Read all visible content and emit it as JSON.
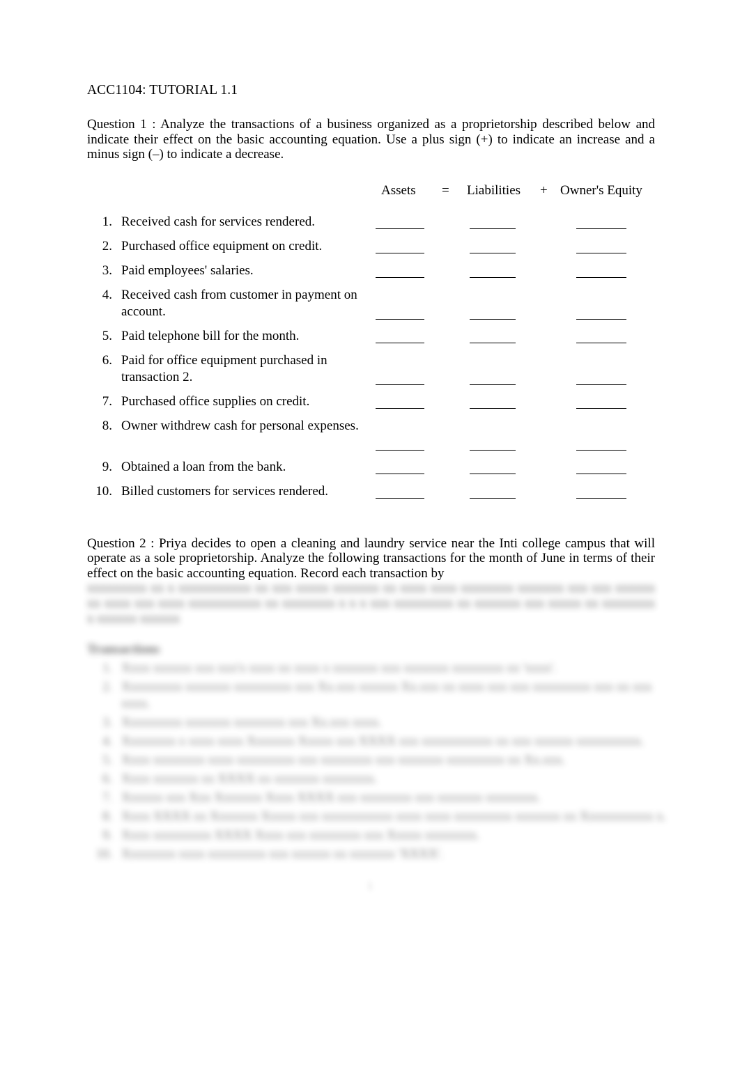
{
  "document": {
    "title": "ACC1104: TUTORIAL 1.1",
    "page_number": "1"
  },
  "question1": {
    "label": "Question 1",
    "body": "  : Analyze the transactions of a business organized as a proprietorship described below and indicate their effect on the basic accounting equation. Use a plus sign (+) to indicate an increase and a minus sign (–) to indicate a decrease.",
    "equation_headers": {
      "assets": "Assets",
      "equals": "=",
      "liabilities": "Liabilities",
      "plus": "+",
      "owners_equity": "Owner's Equity"
    },
    "items": [
      {
        "number": "1.",
        "text": "Received cash for services rendered."
      },
      {
        "number": "2.",
        "text": "Purchased office equipment on credit."
      },
      {
        "number": "3.",
        "text": "Paid employees' salaries."
      },
      {
        "number": "4.",
        "text": "Received cash from customer in payment on account."
      },
      {
        "number": "5.",
        "text": "Paid telephone bill for the month."
      },
      {
        "number": "6.",
        "text": "Paid for office equipment purchased in transaction 2."
      },
      {
        "number": "7.",
        "text": "Purchased office supplies on credit."
      },
      {
        "number": "8.",
        "text": "Owner withdrew cash for personal expenses."
      },
      {
        "number": "9.",
        "text": "Obtained a loan from the bank."
      },
      {
        "number": "10.",
        "text": "Billed customers for services rendered."
      }
    ]
  },
  "question2": {
    "label": "Question 2",
    "body_visible": "  : Priya decides to open a cleaning and laundry service near the Inti college campus that will operate as a sole proprietorship. Analyze the following transactions for the month of June in terms of their effect on the basic accounting equation. Record each transaction by",
    "body_blurred": "xxxxxxxxx xx x xxxxxxxxxxx xx xxx xxxxx xxxxxxx xx xxxx xxxx xxxxxxxx xxxxxxx xxx xxx xxxxxx xx xxxx xxx xxxx xxxxxxxxxxx xx xxxxxxxx x x x xxx xxxxxxxxx xx xxxxxxx xxx xxxxx xx xxxxxxxx x xxxxxx xxxxxx",
    "transactions_heading_blurred": "Transactions",
    "transactions_blurred": [
      {
        "number": "1.",
        "text": "Xxxx xxxxxx xxx xxx'x xxxx xx xxxx x xxxxxxx xxx xxxxxxx xxxxxxxx xx 'xxxx'."
      },
      {
        "number": "2.",
        "text": "Xxxxxxxxx xxxxxxx xxxxxxxxx xxx Xx.xxx xxxxxx Xx.xxx xx xxxx xxx xxx xxxxxxxxx xxx xx xxx xxxx."
      },
      {
        "number": "3.",
        "text": "Xxxxxxxxx xxxxxxx xxxxxxxx xxx Xx.xxx xxxx."
      },
      {
        "number": "4.",
        "text": "Xxxxxxxx x xxxx xxxx Xxxxxxx Xxxxx xxx XXXX xxx xxxxxxxxxxx xx xxx xxxxxx xxxxxxxxxx."
      },
      {
        "number": "5.",
        "text": "Xxxx xxxxxxxx xxxx xxxxxxxxx xxx xxxxxxxx xxx xxxxxxx xxxxxxxxx xx Xx.xxx."
      },
      {
        "number": "6.",
        "text": "Xxxx xxxxxxx xx XXXX xx xxxxxxx xxxxxxxx."
      },
      {
        "number": "7.",
        "text": "Xxxxxx xxx Xxx Xxxxxxx Xxxx XXXX xxx xxxxxxxx xxx xxxxxxx xxxxxxxx."
      },
      {
        "number": "8.",
        "text": "Xxxx XXXX xx Xxxxxxx Xxxxx xxx xxxxxxxxxxx xxxx xxxx xxxxxxxxx xxxxxxx xx Xxxxxxxxxxx x."
      },
      {
        "number": "9.",
        "text": "Xxxx xxxxxxxxx XXXX Xxxx xxx xxxxxxxx xxx Xxxxx xxxxxxxx."
      },
      {
        "number": "10.",
        "text": "Xxxxxxxx xxxx xxxxxxxxx xxx xxxxxx xx xxxxxxx 'XXXX'."
      }
    ]
  }
}
